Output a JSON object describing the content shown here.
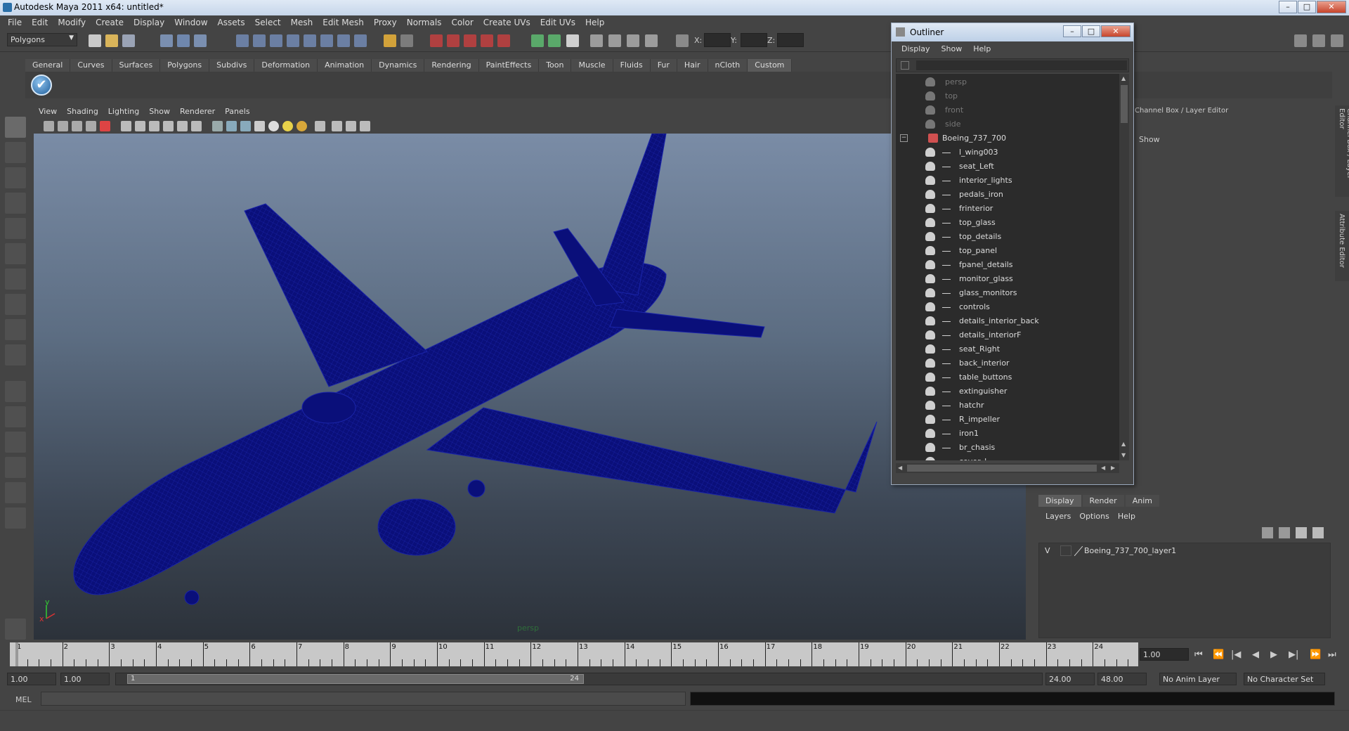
{
  "window": {
    "title": "Autodesk Maya 2011 x64: untitled*"
  },
  "menubar": [
    "File",
    "Edit",
    "Modify",
    "Create",
    "Display",
    "Window",
    "Assets",
    "Select",
    "Mesh",
    "Edit Mesh",
    "Proxy",
    "Normals",
    "Color",
    "Create UVs",
    "Edit UVs",
    "Help"
  ],
  "statusline": {
    "mode": "Polygons",
    "x_label": "X:",
    "y_label": "Y:",
    "z_label": "Z:"
  },
  "shelf": {
    "tabs": [
      "General",
      "Curves",
      "Surfaces",
      "Polygons",
      "Subdivs",
      "Deformation",
      "Animation",
      "Dynamics",
      "Rendering",
      "PaintEffects",
      "Toon",
      "Muscle",
      "Fluids",
      "Fur",
      "Hair",
      "nCloth",
      "Custom"
    ],
    "active_tab": "Custom"
  },
  "viewport": {
    "menu": [
      "View",
      "Shading",
      "Lighting",
      "Show",
      "Renderer",
      "Panels"
    ],
    "camera_label": "persp",
    "axis_x": "x",
    "axis_y": "y",
    "wire_color": "#0a0f7a"
  },
  "outliner": {
    "title": "Outliner",
    "menu": [
      "Display",
      "Show",
      "Help"
    ],
    "cameras": [
      "persp",
      "top",
      "front",
      "side"
    ],
    "root": "Boeing_737_700",
    "children": [
      "l_wing003",
      "seat_Left",
      "interior_lights",
      "pedals_iron",
      "frinterior",
      "top_glass",
      "top_details",
      "top_panel",
      "fpanel_details",
      "monitor_glass",
      "glass_monitors",
      "controls",
      "details_interior_back",
      "details_interiorF",
      "seat_Right",
      "back_interior",
      "table_buttons",
      "extinguisher",
      "hatchr",
      "R_impeller",
      "iron1",
      "br_chasis",
      "cover_l"
    ]
  },
  "channel_box": {
    "title": "Channel Box / Layer Editor",
    "show_label": "Show",
    "side_tab_1": "Channel Box / Layer Editor",
    "side_tab_2": "Attribute Editor"
  },
  "layer_editor": {
    "tabs": [
      "Display",
      "Render",
      "Anim"
    ],
    "active_tab": "Display",
    "menu": [
      "Layers",
      "Options",
      "Help"
    ],
    "layer": {
      "visible": "V",
      "name": "Boeing_737_700_layer1"
    }
  },
  "timeline": {
    "ticks": [
      "1",
      "2",
      "3",
      "4",
      "5",
      "6",
      "7",
      "8",
      "9",
      "10",
      "11",
      "12",
      "13",
      "14",
      "15",
      "16",
      "17",
      "18",
      "19",
      "20",
      "21",
      "22",
      "23",
      "24"
    ],
    "current_frame": "1.00",
    "range_start": "1.00",
    "playback_start": "1.00",
    "slider_start_label": "1",
    "slider_end_label": "24",
    "playback_end": "24.00",
    "range_end": "48.00",
    "anim_layer": "No Anim Layer",
    "character_set": "No Character Set"
  },
  "cmdline": {
    "label": "MEL"
  }
}
